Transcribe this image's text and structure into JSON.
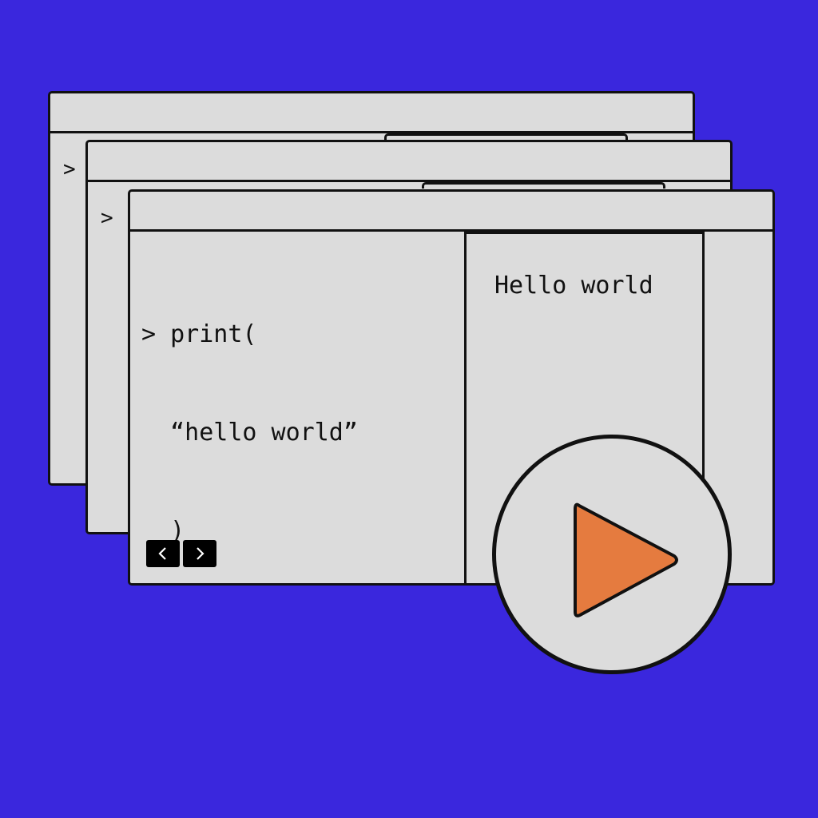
{
  "colors": {
    "background": "#3a27dd",
    "window": "#dcdcdc",
    "border": "#111111",
    "play_triangle": "#e57b3f"
  },
  "back_windows": [
    {
      "prompt": ">"
    },
    {
      "prompt": ">"
    }
  ],
  "main_window": {
    "code_lines": [
      "> print(",
      "  “hello world”",
      "  )"
    ],
    "output": "Hello world",
    "nav": {
      "prev_icon": "chevron-left-icon",
      "next_icon": "chevron-right-icon"
    }
  },
  "play_button": {
    "icon": "play-icon"
  }
}
